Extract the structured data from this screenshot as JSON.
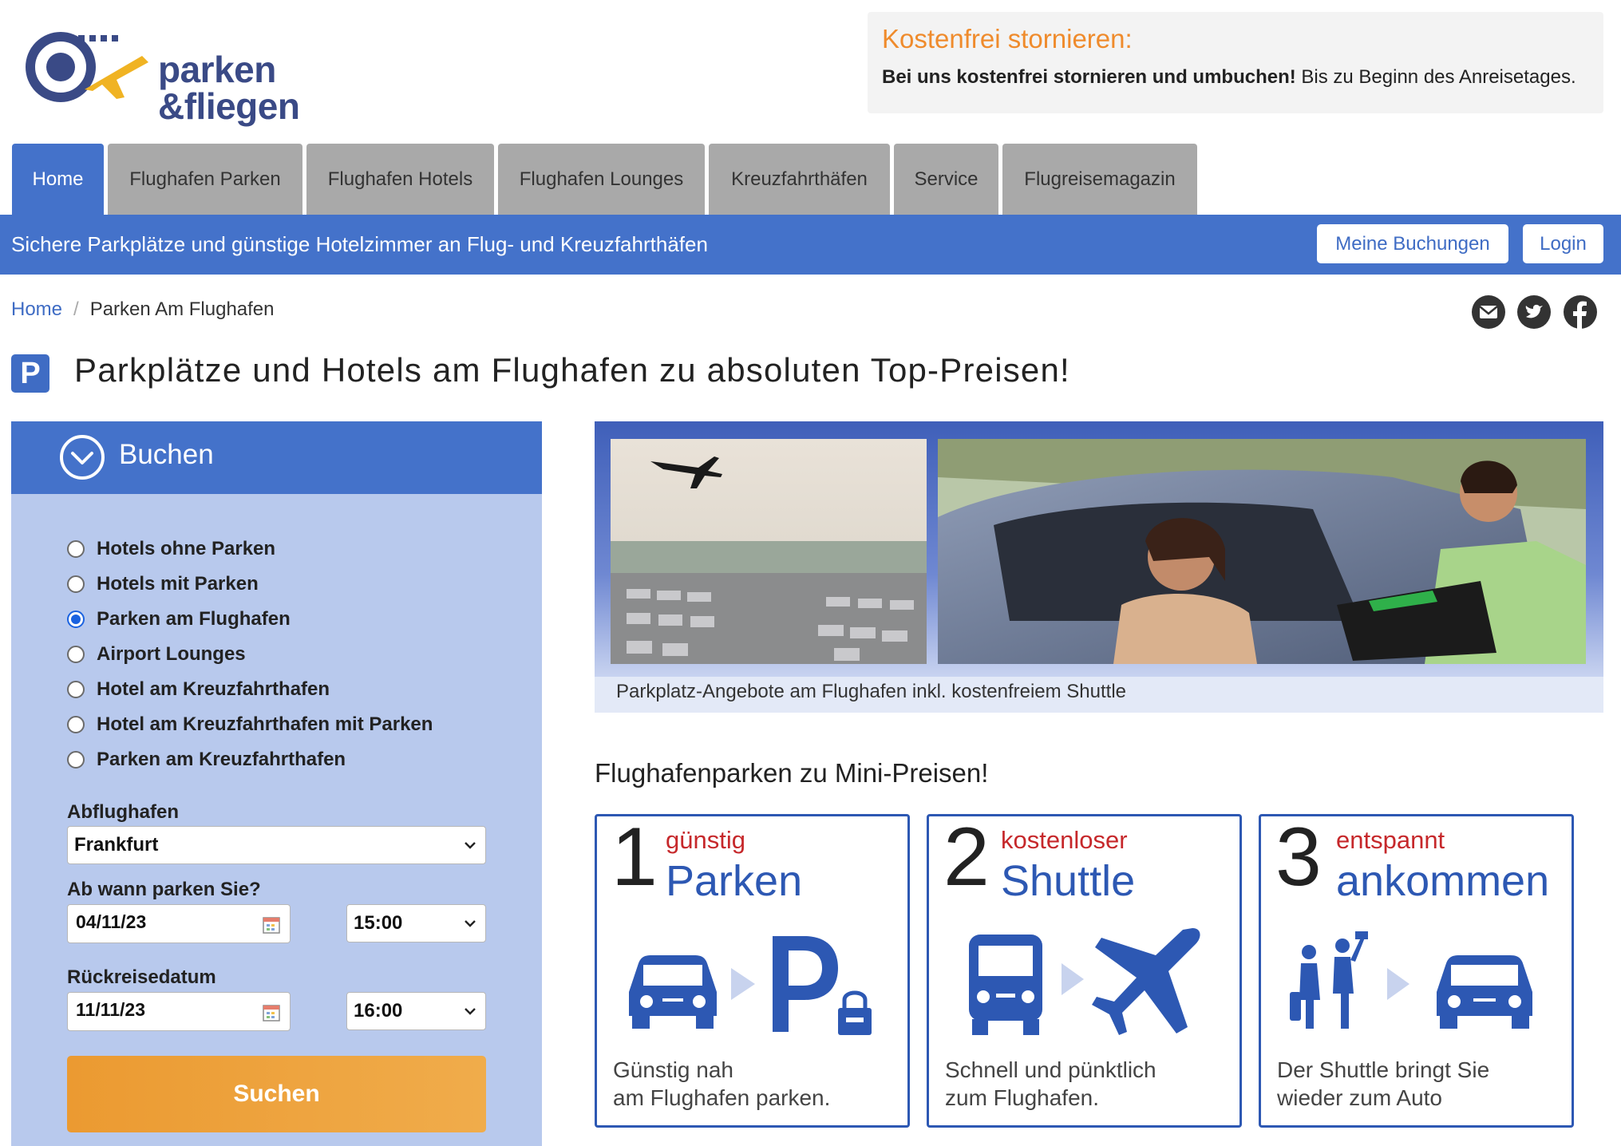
{
  "logo": {
    "line1": "parken",
    "line2": "&fliegen"
  },
  "notice": {
    "title": "Kostenfrei stornieren:",
    "bold": "Bei uns kostenfrei stornieren und umbuchen!",
    "rest": " Bis zu Beginn des Anreisetages."
  },
  "nav": {
    "tabs": [
      "Home",
      "Flughafen Parken",
      "Flughafen Hotels",
      "Flughafen Lounges",
      "Kreuzfahrthäfen",
      "Service",
      "Flugreisemagazin"
    ],
    "active": "Home"
  },
  "band": {
    "tagline": "Sichere Parkplätze und günstige Hotelzimmer an Flug- und Kreuzfahrthäfen",
    "bookings": "Meine Buchungen",
    "login": "Login"
  },
  "breadcrumb": {
    "home": "Home",
    "separator": "/",
    "current": "Parken Am Flughafen"
  },
  "social": [
    "mail-icon",
    "twitter-icon",
    "facebook-icon"
  ],
  "heading": {
    "badge": "P",
    "title": "Parkplätze und Hotels am Flughafen zu absoluten Top-Preisen!"
  },
  "booking": {
    "title": "Buchen",
    "options": [
      {
        "label": "Hotels ohne Parken",
        "checked": false
      },
      {
        "label": "Hotels mit Parken",
        "checked": false
      },
      {
        "label": "Parken am Flughafen",
        "checked": true
      },
      {
        "label": "Airport Lounges",
        "checked": false
      },
      {
        "label": "Hotel am Kreuzfahrthafen",
        "checked": false
      },
      {
        "label": "Hotel am Kreuzfahrthafen mit Parken",
        "checked": false
      },
      {
        "label": "Parken am Kreuzfahrthafen",
        "checked": false
      }
    ],
    "airport_label": "Abflughafen",
    "airport_value": "Frankfurt",
    "start_label": "Ab wann parken Sie?",
    "start_date": "04/11/23",
    "start_time": "15:00",
    "return_label": "Rückreisedatum",
    "return_date": "11/11/23",
    "return_time": "16:00",
    "search": "Suchen"
  },
  "hero": {
    "caption": "Parkplatz-Angebote am Flughafen inkl. kostenfreiem Shuttle"
  },
  "steps_title": "Flughafenparken zu Mini-Preisen!",
  "steps": [
    {
      "num": "1",
      "small": "günstig",
      "big": "Parken",
      "desc1": "Günstig nah",
      "desc2": "am Flughafen parken."
    },
    {
      "num": "2",
      "small": "kostenloser",
      "big": "Shuttle",
      "desc1": "Schnell und pünktlich",
      "desc2": "zum Flughafen."
    },
    {
      "num": "3",
      "small": "entspannt",
      "big": "ankommen",
      "desc1": "Der Shuttle bringt Sie",
      "desc2": "wieder zum Auto"
    }
  ],
  "colors": {
    "brand_blue": "#4472ca",
    "accent_orange": "#ef8b2c",
    "panel_blue": "#b8c9ed",
    "step_red": "#c6282b"
  }
}
